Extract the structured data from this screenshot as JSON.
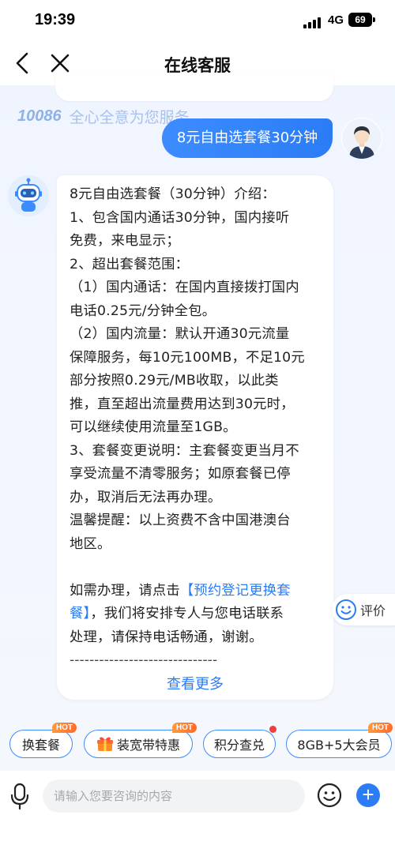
{
  "status": {
    "time": "19:39",
    "network": "4G",
    "battery": "69"
  },
  "nav": {
    "title": "在线客服"
  },
  "watermark": {
    "logo": "10086",
    "slogan": "全心全意为您服务"
  },
  "user_message": "8元自由选套餐30分钟",
  "bot_message": {
    "lines": [
      "8元自由选套餐（30分钟）介绍：",
      "1、包含国内通话30分钟，国内接听",
      "免费，来电显示；",
      "2、超出套餐范围：",
      "（1）国内通话：在国内直接拨打国内",
      "电话0.25元/分钟全包。",
      "（2）国内流量：默认开通30元流量",
      "保障服务，每10元100MB，不足10元",
      "部分按照0.29元/MB收取，以此类",
      "推，直至超出流量费用达到30元时，",
      "可以继续使用流量至1GB。",
      "3、套餐变更说明：主套餐变更当月不",
      "享受流量不清零服务；如原套餐已停",
      "办，取消后无法再办理。",
      "温馨提醒：以上资费不含中国港澳台",
      "地区。"
    ],
    "action_prefix": "如需办理，请点击",
    "action_link_1": "【预约登记更换套",
    "action_link_2": "餐】",
    "action_suffix_1": "，我们将安排专人与您电话联系",
    "action_line_3": "处理，请保持电话畅通，谢谢。",
    "divider": "------------------------------",
    "see_more": "查看更多"
  },
  "rate": {
    "label": "评价"
  },
  "quick_actions": [
    {
      "label": "换套餐",
      "badge": "HOT"
    },
    {
      "label": "装宽带特惠",
      "badge": "HOT"
    },
    {
      "label": "积分查兑"
    },
    {
      "label": "8GB+5大会员",
      "badge": "HOT"
    }
  ],
  "input": {
    "placeholder": "请输入您要咨询的内容"
  },
  "colors": {
    "accent": "#2b7cf5",
    "hot": "#ff7a2c",
    "dot": "#f03d3d"
  }
}
